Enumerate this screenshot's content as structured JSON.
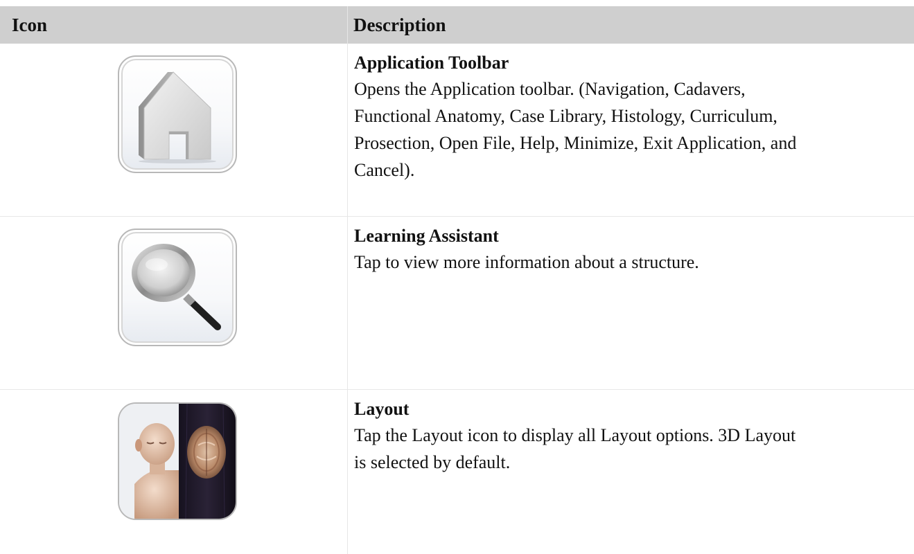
{
  "table": {
    "headers": {
      "icon": "Icon",
      "description": "Description"
    },
    "rows": [
      {
        "icon": "home-icon",
        "title": "Application Toolbar",
        "lines": [
          "Opens the Application toolbar. (Navigation, Cadavers,",
          "Functional Anatomy, Case Library, Histology, Curriculum,",
          "Prosection, Open File, Help, Minimize, Exit Application, and",
          "Cancel)."
        ]
      },
      {
        "icon": "magnifier-icon",
        "title": "Learning Assistant",
        "lines": [
          "Tap to view more information about a structure."
        ]
      },
      {
        "icon": "layout-icon",
        "title": "Layout",
        "lines": [
          "Tap the Layout icon to display all Layout options.  3D Layout",
          "is selected by default."
        ]
      }
    ]
  }
}
